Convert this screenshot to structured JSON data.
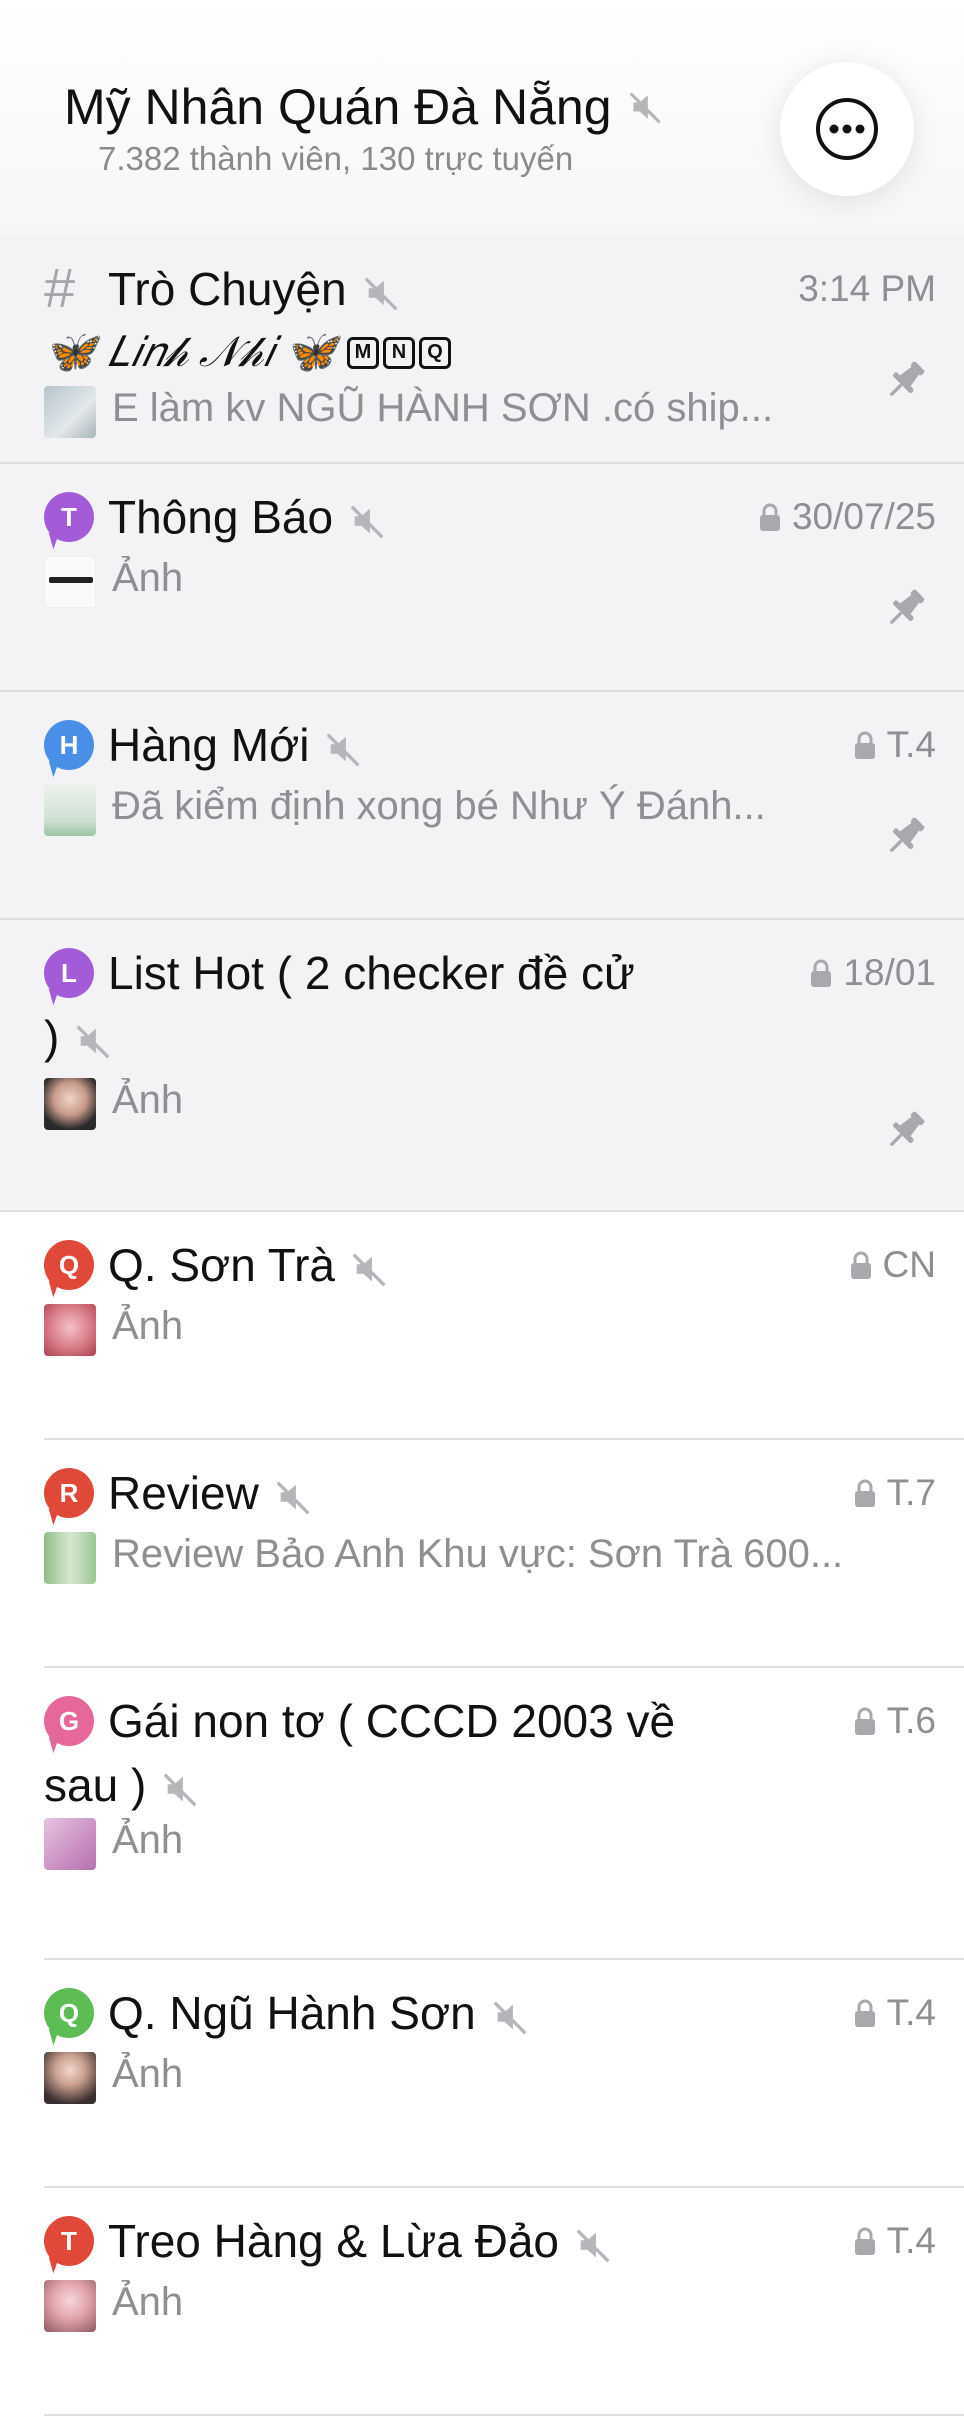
{
  "header": {
    "title": "Mỹ Nhân Quán Đà Nẵng",
    "subtitle": "7.382 thành viên, 130 trực tuyến",
    "more_icon": "ellipsis-circle-icon"
  },
  "colors": {
    "accent_purple": "#a35bd8",
    "accent_blue": "#4a8fe6",
    "accent_red": "#e0493a",
    "accent_pink": "#e6679a",
    "accent_green": "#5ebc55",
    "muted_text": "#8e8e93",
    "pinned_bg": "#f3f3f5"
  },
  "topics": [
    {
      "title": "Trò Chuyện",
      "time": "3:14 PM",
      "sender": "🦋 𝐿𝑖𝑛𝒽 𝒩𝒽𝑖 🦋",
      "sender_tags": [
        "M",
        "N",
        "Q"
      ],
      "preview": "E làm kv NGŨ HÀNH SƠN .có ship...",
      "locked": false,
      "pinned": true,
      "icon": "hash-icon"
    },
    {
      "title": "Thông Báo",
      "time": "30/07/25",
      "letter": "T",
      "preview": "Ảnh",
      "locked": true,
      "pinned": true
    },
    {
      "title": "Hàng Mới",
      "time": "T.4",
      "letter": "H",
      "preview": "Đã kiểm định xong bé Như Ý Đánh...",
      "locked": true,
      "pinned": true
    },
    {
      "title_line1": "List Hot ( 2 checker đề cử",
      "title_line2": ")",
      "time": "18/01",
      "letter": "L",
      "preview": "Ảnh",
      "locked": true,
      "pinned": true
    },
    {
      "title": "Q. Sơn Trà",
      "time": "CN",
      "letter": "Q",
      "preview": "Ảnh",
      "locked": true,
      "pinned": false
    },
    {
      "title": "Review",
      "time": "T.7",
      "letter": "R",
      "preview": "Review Bảo Anh Khu vực: Sơn Trà 600...",
      "locked": true,
      "pinned": false
    },
    {
      "title_line1": "Gái non tơ ( CCCD 2003 về",
      "title_line2": "sau )",
      "time": "T.6",
      "letter": "G",
      "preview": "Ảnh",
      "locked": true,
      "pinned": false
    },
    {
      "title": "Q. Ngũ Hành Sơn",
      "time": "T.4",
      "letter": "Q",
      "preview": "Ảnh",
      "locked": true,
      "pinned": false
    },
    {
      "title": "Treo Hàng & Lừa Đảo",
      "time": "T.4",
      "letter": "T",
      "preview": "Ảnh",
      "locked": true,
      "pinned": false
    }
  ]
}
